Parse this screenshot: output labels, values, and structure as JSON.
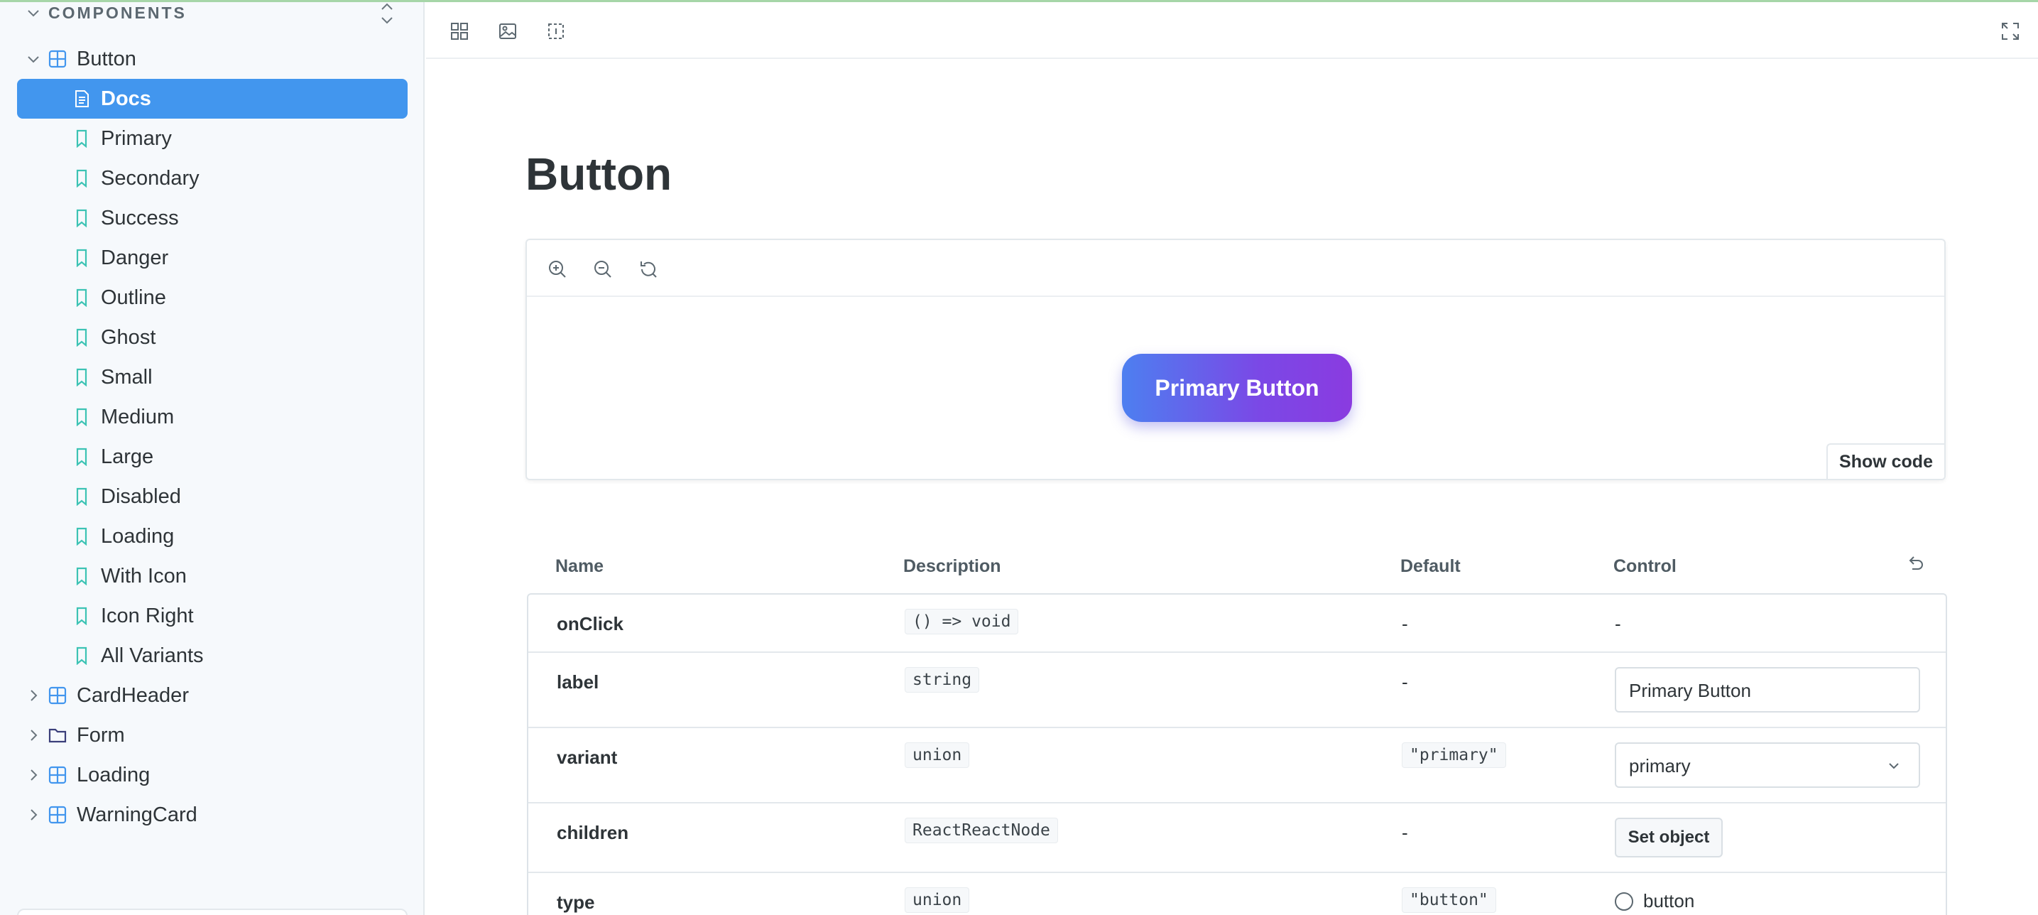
{
  "sidebar": {
    "section_title": "COMPONENTS",
    "items": [
      {
        "label": "Button",
        "type": "component",
        "expanded": true
      },
      {
        "label": "Docs",
        "type": "docs",
        "active": true
      },
      {
        "label": "Primary",
        "type": "story"
      },
      {
        "label": "Secondary",
        "type": "story"
      },
      {
        "label": "Success",
        "type": "story"
      },
      {
        "label": "Danger",
        "type": "story"
      },
      {
        "label": "Outline",
        "type": "story"
      },
      {
        "label": "Ghost",
        "type": "story"
      },
      {
        "label": "Small",
        "type": "story"
      },
      {
        "label": "Medium",
        "type": "story"
      },
      {
        "label": "Large",
        "type": "story"
      },
      {
        "label": "Disabled",
        "type": "story"
      },
      {
        "label": "Loading",
        "type": "story"
      },
      {
        "label": "With Icon",
        "type": "story"
      },
      {
        "label": "Icon Right",
        "type": "story"
      },
      {
        "label": "All Variants",
        "type": "story"
      },
      {
        "label": "CardHeader",
        "type": "component",
        "expanded": false
      },
      {
        "label": "Form",
        "type": "folder",
        "expanded": false
      },
      {
        "label": "Loading",
        "type": "component",
        "expanded": false
      },
      {
        "label": "WarningCard",
        "type": "component",
        "expanded": false
      }
    ]
  },
  "toolbar": {
    "icons": [
      "grid-icon",
      "image-icon",
      "outline-icon",
      "fullscreen-icon"
    ]
  },
  "page": {
    "title": "Button"
  },
  "canvas": {
    "zoom_icons": [
      "zoom-in-icon",
      "zoom-out-icon",
      "zoom-reset-icon"
    ],
    "preview_button_label": "Primary Button",
    "show_code_label": "Show code"
  },
  "args_table": {
    "headers": {
      "name": "Name",
      "description": "Description",
      "default": "Default",
      "control": "Control"
    },
    "rows": [
      {
        "name": "onClick",
        "description": "() => void",
        "default": "-",
        "control": "-"
      },
      {
        "name": "label",
        "description": "string",
        "default": "-",
        "control": "Primary Button"
      },
      {
        "name": "variant",
        "description": "union",
        "default": "\"primary\"",
        "control": "primary"
      },
      {
        "name": "children",
        "description": "ReactReactNode",
        "default": "-",
        "control": "Set object"
      },
      {
        "name": "type",
        "description": "union",
        "default": "\"button\"",
        "control": "button"
      }
    ]
  },
  "colors": {
    "accent": "#4296ee",
    "story_icon": "#3cc3b4",
    "component_icon": "#4296ee",
    "button_gradient_start": "#4d7ff0",
    "button_gradient_end": "#8a3be0"
  }
}
